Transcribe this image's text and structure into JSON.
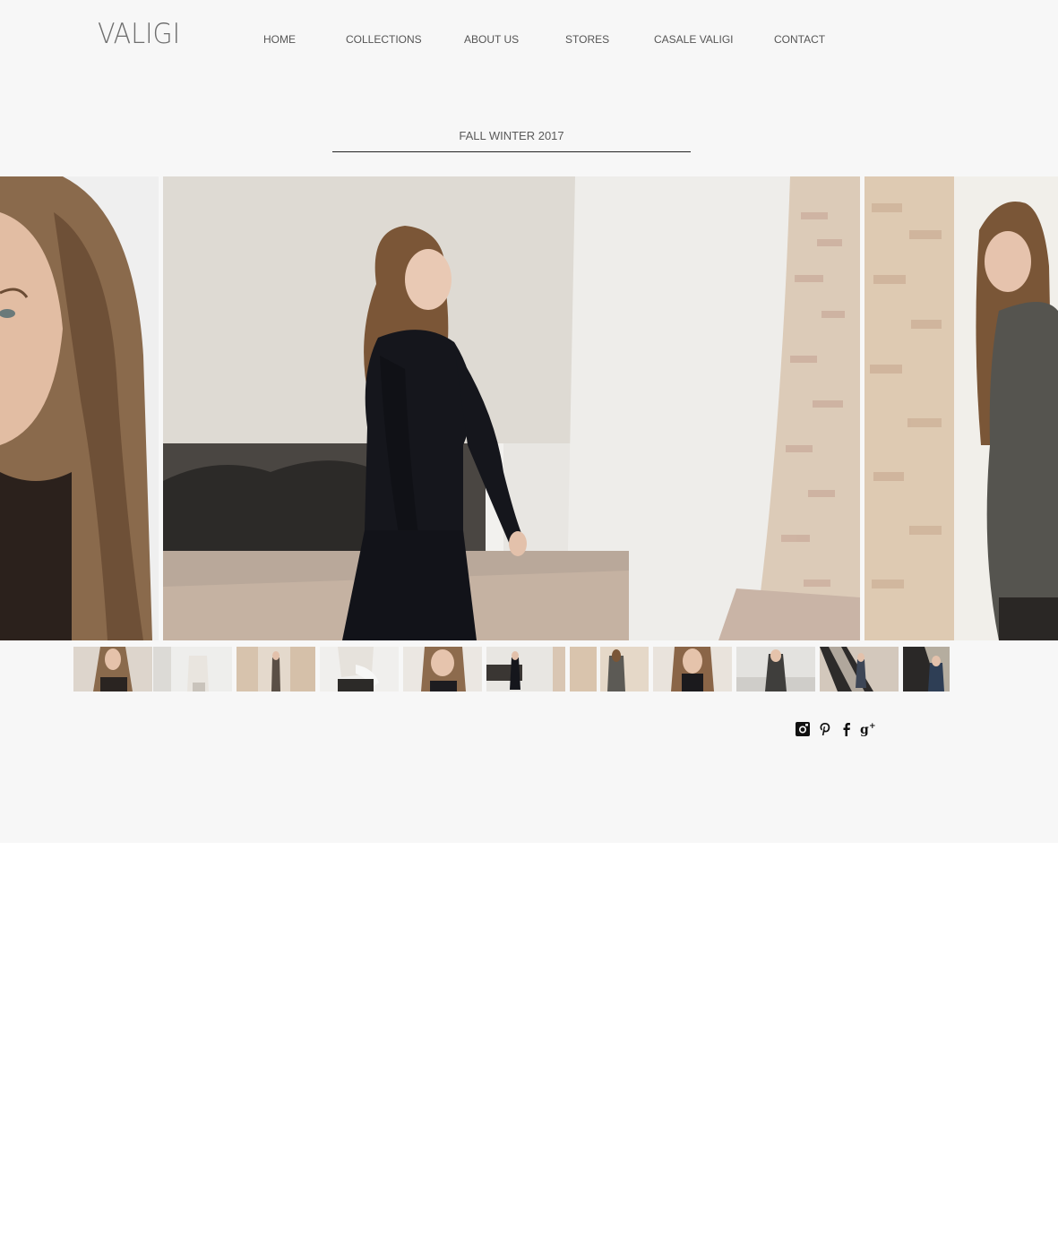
{
  "brand": {
    "logo": "VALIGI"
  },
  "nav": {
    "items": [
      {
        "label": "HOME"
      },
      {
        "label": "COLLECTIONS"
      },
      {
        "label": "ABOUT US"
      },
      {
        "label": "STORES"
      },
      {
        "label": "CASALE VALIGI"
      },
      {
        "label": "CONTACT"
      }
    ]
  },
  "collection": {
    "title": "FALL WINTER 2017"
  },
  "gallery": {
    "slides": [
      {
        "name": "portrait-closeup-freckles",
        "tone": "#d8c8b8"
      },
      {
        "name": "walking-black-knit-fireplace",
        "tone": "#e9e6e0"
      },
      {
        "name": "grey-cardigan-brick-wall",
        "tone": "#e4d6c4"
      }
    ],
    "thumbnail_count": 11
  },
  "social": {
    "icons": [
      "instagram-icon",
      "pinterest-icon",
      "facebook-icon",
      "google-plus-icon"
    ]
  },
  "colors": {
    "page_bg": "#f7f7f7",
    "text": "#555555",
    "rule": "#222222"
  }
}
